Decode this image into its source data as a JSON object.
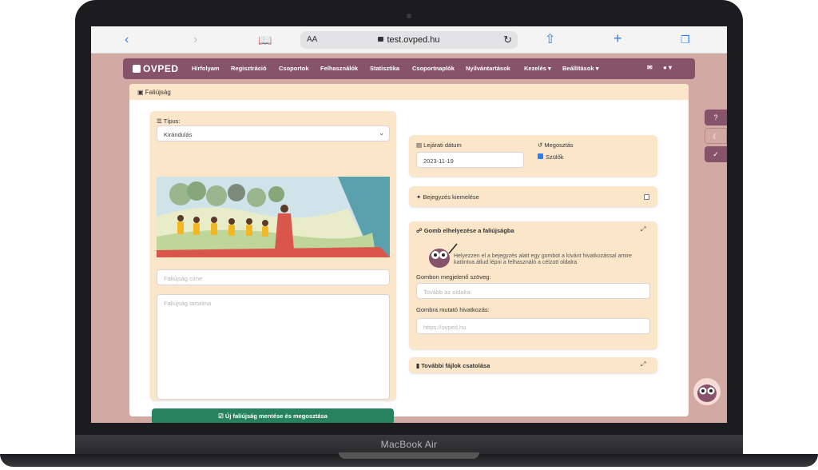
{
  "device": {
    "model_label": "MacBook Air"
  },
  "browser": {
    "text_size_label": "AA",
    "url": "test.ovped.hu",
    "icons": [
      "chevron-left-icon",
      "chevron-right-icon",
      "book-icon",
      "lock-icon",
      "reload-icon",
      "share-icon",
      "plus-icon",
      "tabs-icon"
    ]
  },
  "nav": {
    "brand": "OVPED",
    "items": [
      "Hírfolyam",
      "Regisztráció",
      "Csoportok",
      "Felhasználók",
      "Statisztika",
      "Csoportnaplók",
      "Nyilvántartások",
      "Kezelés",
      "Beállítások"
    ],
    "dropdown_items": [
      "Kezelés",
      "Beállítások"
    ]
  },
  "card": {
    "title": "Faliújság"
  },
  "form": {
    "type_label": "Típus:",
    "type_value": "Kirándulás",
    "title_placeholder": "Faliújság címe",
    "content_placeholder": "Faliújság tartalma",
    "save_label": "Új faliújság mentése és megosztása"
  },
  "expiry": {
    "label": "Lejárati dátum",
    "value": "2023-11-19"
  },
  "sharing": {
    "label": "Megosztás",
    "option_label": "Szülők",
    "checked": true
  },
  "highlight": {
    "label": "Bejegyzés kiemelése",
    "checked": false
  },
  "button_section": {
    "title": "Gomb elhelyezése a faliújságba",
    "help_line1": "Helyezzen el a bejegyzés alatt egy gombot a kívánt hivatkozással amire",
    "help_line2": "kattintva átlud lépni a felhasználó a célzott oldalra",
    "text_label": "Gombon megjelenő szöveg:",
    "text_placeholder": "Tovább az oldalra",
    "link_label": "Gombra mutató hivatkozás:",
    "link_placeholder": "https://ovped.hu"
  },
  "files_section": {
    "title": "További fájlok csatolása"
  },
  "colors": {
    "nav": "#86536b",
    "panel": "#fbe6c9",
    "save": "#27835f",
    "page_bg": "#d3a9a3"
  }
}
